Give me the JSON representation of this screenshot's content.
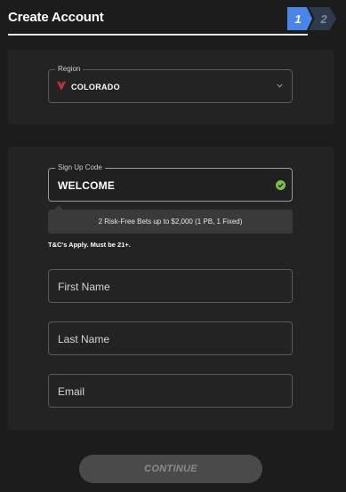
{
  "header": {
    "title": "Create Account",
    "steps": [
      {
        "label": "1",
        "active": true
      },
      {
        "label": "2",
        "active": false
      }
    ]
  },
  "region": {
    "label": "Region",
    "value": "COLORADO",
    "icon": "state-logo-icon",
    "dropdown_icon": "chevron-down-icon"
  },
  "signup_code": {
    "label": "Sign Up Code",
    "value": "WELCOME",
    "status_icon": "check-circle-icon",
    "promo": "2 Risk-Free Bets up to $2,000 (1 PB, 1 Fixed)"
  },
  "terms": "T&C's Apply. Must be 21+.",
  "fields": {
    "first_name": "First Name",
    "last_name": "Last Name",
    "email": "Email"
  },
  "continue_label": "CONTINUE",
  "colors": {
    "accent": "#4a86e8",
    "success": "#7cc242",
    "region_icon": "#e0303a",
    "background": "#1c1c1c",
    "card": "#232323"
  }
}
